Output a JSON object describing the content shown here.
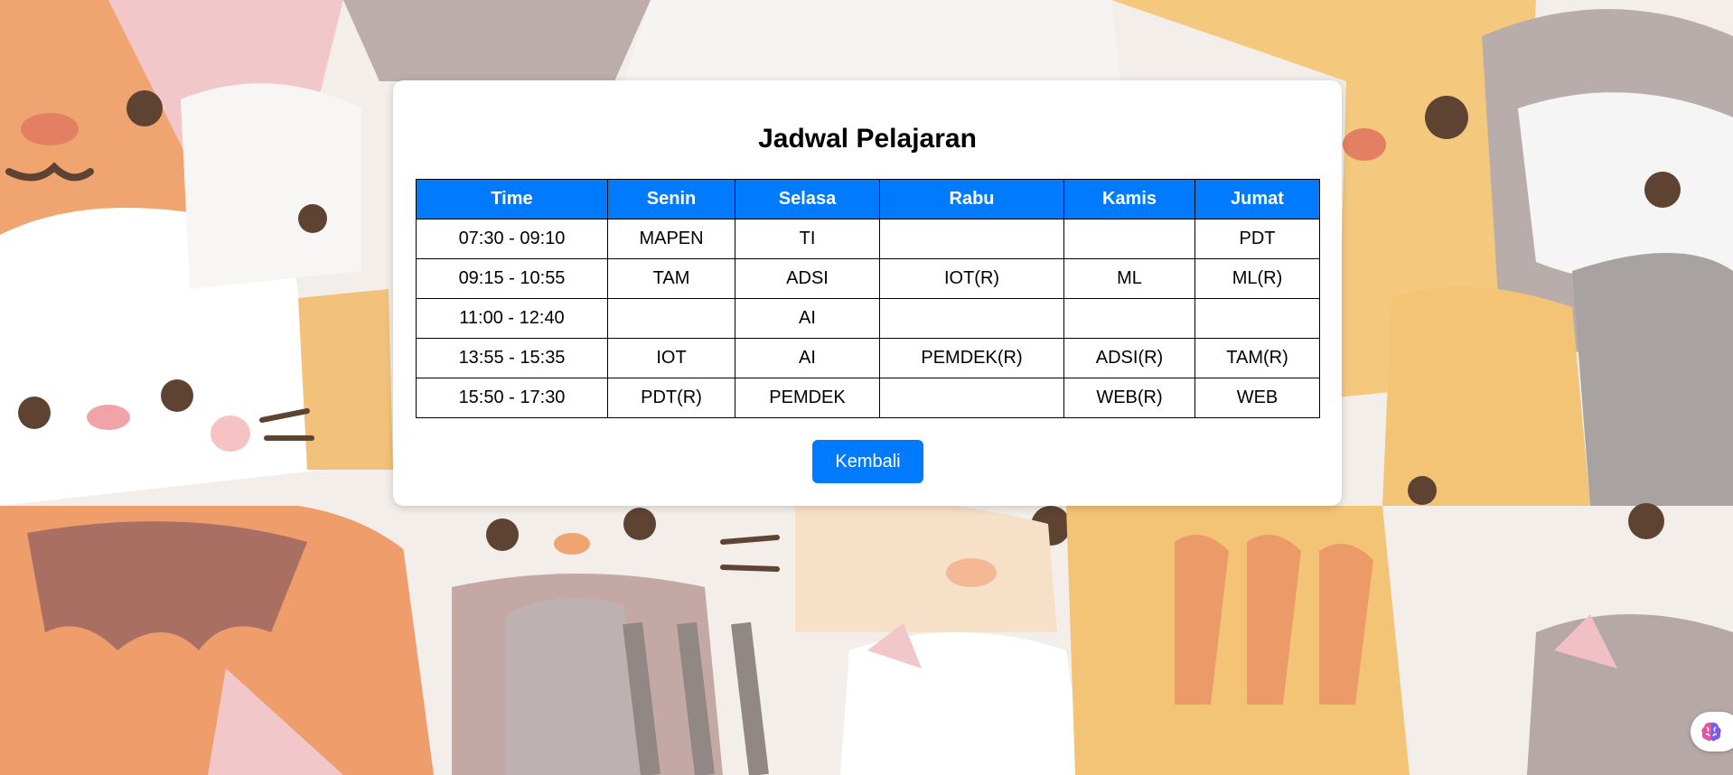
{
  "page": {
    "title": "Jadwal Pelajaran",
    "back_label": "Kembali"
  },
  "table": {
    "headers": [
      "Time",
      "Senin",
      "Selasa",
      "Rabu",
      "Kamis",
      "Jumat"
    ],
    "rows": [
      [
        "07:30 - 09:10",
        "MAPEN",
        "TI",
        "",
        "",
        "PDT"
      ],
      [
        "09:15 - 10:55",
        "TAM",
        "ADSI",
        "IOT(R)",
        "ML",
        "ML(R)"
      ],
      [
        "11:00 - 12:40",
        "",
        "AI",
        "",
        "",
        ""
      ],
      [
        "13:55 - 15:35",
        "IOT",
        "AI",
        "PEMDEK(R)",
        "ADSI(R)",
        "TAM(R)"
      ],
      [
        "15:50 - 17:30",
        "PDT(R)",
        "PEMDEK",
        "",
        "WEB(R)",
        "WEB"
      ]
    ]
  },
  "background": {
    "theme": "cat-pattern-wallpaper"
  },
  "extension": {
    "icon": "brain-icon"
  },
  "colors": {
    "accent": "#007bff",
    "card": "#ffffff"
  }
}
